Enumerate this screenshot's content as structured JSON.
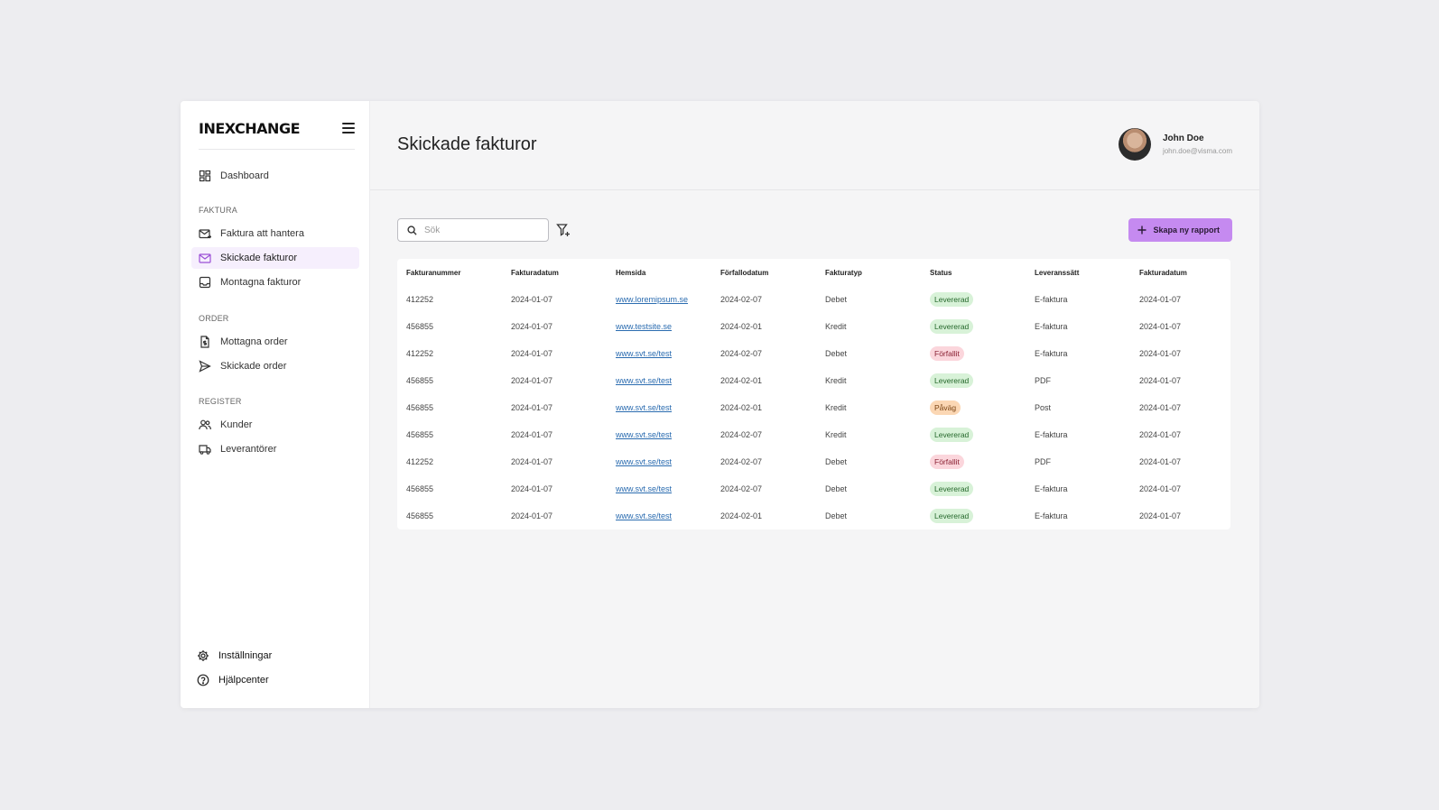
{
  "brand": {
    "logo": "INEXCHANGE"
  },
  "sidebar": {
    "dashboard": "Dashboard",
    "sections": [
      {
        "label": "FAKTURA",
        "items": [
          "Faktura att hantera",
          "Skickade fakturor",
          "Montagna fakturor"
        ]
      },
      {
        "label": "ORDER",
        "items": [
          "Mottagna order",
          "Skickade order"
        ]
      },
      {
        "label": "REGISTER",
        "items": [
          "Kunder",
          "Leverantörer"
        ]
      }
    ],
    "active_item": "Skickade fakturor",
    "footer": [
      "Inställningar",
      "Hjälpcenter"
    ]
  },
  "header": {
    "title": "Skickade fakturor",
    "user": {
      "name": "John Doe",
      "email": "john.doe@visma.com"
    }
  },
  "toolbar": {
    "search_placeholder": "Sök",
    "create_label": "Skapa ny rapport"
  },
  "colors": {
    "accent": "#c58af0",
    "levererad": "#d8f2d8",
    "forfallit": "#fbd6dc",
    "pavag": "#fbd7b4"
  },
  "table": {
    "columns": [
      "Fakturanummer",
      "Fakturadatum",
      "Hemsida",
      "Förfallodatum",
      "Fakturatyp",
      "Status",
      "Leveranssätt",
      "Fakturadatum"
    ],
    "rows": [
      [
        "412252",
        "2024-01-07",
        "www.loremipsum.se",
        "2024-02-07",
        "Debet",
        "Levererad",
        "E-faktura",
        "2024-01-07"
      ],
      [
        "456855",
        "2024-01-07",
        "www.testsite.se",
        "2024-02-01",
        "Kredit",
        "Levererad",
        "E-faktura",
        "2024-01-07"
      ],
      [
        "412252",
        "2024-01-07",
        "www.svt.se/test",
        "2024-02-07",
        "Debet",
        "Förfallit",
        "E-faktura",
        "2024-01-07"
      ],
      [
        "456855",
        "2024-01-07",
        "www.svt.se/test",
        "2024-02-01",
        "Kredit",
        "Levererad",
        "PDF",
        "2024-01-07"
      ],
      [
        "456855",
        "2024-01-07",
        "www.svt.se/test",
        "2024-02-01",
        "Kredit",
        "Påväg",
        "Post",
        "2024-01-07"
      ],
      [
        "456855",
        "2024-01-07",
        "www.svt.se/test",
        "2024-02-07",
        "Kredit",
        "Levererad",
        "E-faktura",
        "2024-01-07"
      ],
      [
        "412252",
        "2024-01-07",
        "www.svt.se/test",
        "2024-02-07",
        "Debet",
        "Förfallit",
        "PDF",
        "2024-01-07"
      ],
      [
        "456855",
        "2024-01-07",
        "www.svt.se/test",
        "2024-02-07",
        "Debet",
        "Levererad",
        "E-faktura",
        "2024-01-07"
      ],
      [
        "456855",
        "2024-01-07",
        "www.svt.se/test",
        "2024-02-01",
        "Debet",
        "Levererad",
        "E-faktura",
        "2024-01-07"
      ]
    ]
  }
}
